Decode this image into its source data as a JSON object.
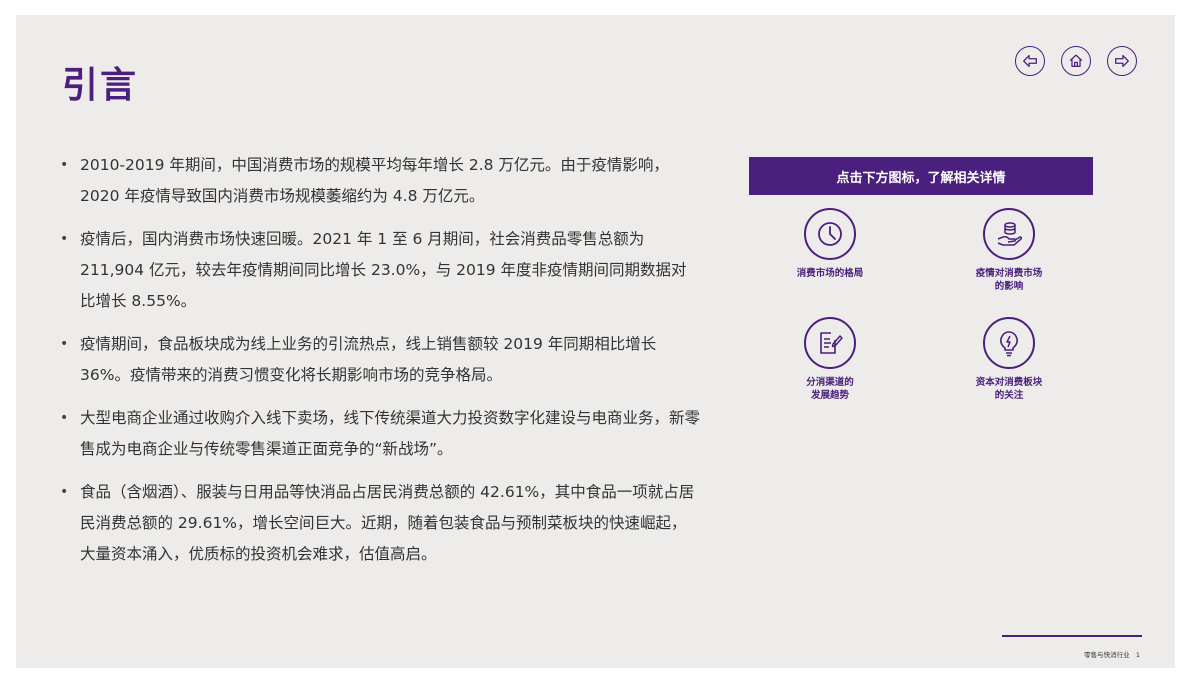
{
  "title": "引言",
  "nav": {
    "back_icon": "arrow-left-icon",
    "home_icon": "home-icon",
    "forward_icon": "arrow-right-icon"
  },
  "bullets": [
    "2010-2019 年期间，中国消费市场的规模平均每年增长 2.8 万亿元。由于疫情影响，2020 年疫情导致国内消费市场规模萎缩约为 4.8 万亿元。",
    "疫情后，国内消费市场快速回暖。2021 年 1 至 6 月期间，社会消费品零售总额为 211,904 亿元，较去年疫情期间同比增长 23.0%，与 2019 年度非疫情期间同期数据对比增长 8.55%。",
    "疫情期间，食品板块成为线上业务的引流热点，线上销售额较 2019 年同期相比增长 36%。疫情带来的消费习惯变化将长期影响市场的竞争格局。",
    "大型电商企业通过收购介入线下卖场，线下传统渠道大力投资数字化建设与电商业务，新零售成为电商企业与传统零售渠道正面竞争的“新战场”。",
    "食品（含烟酒）、服装与日用品等快消品占居民消费总额的 42.61%，其中食品一项就占居民消费总额的 29.61%，增长空间巨大。近期，随着包装食品与预制菜板块的快速崛起，大量资本涌入，优质标的投资机会难求，估值高启。"
  ],
  "panel": {
    "header": "点击下方图标，了解相关详情",
    "tiles": [
      {
        "label": "消费市场的格局",
        "icon": "clock-icon"
      },
      {
        "label": "疫情对消费市场\n的影响",
        "icon": "coins-hand-icon"
      },
      {
        "label": "分消渠道的\n发展趋势",
        "icon": "document-edit-icon"
      },
      {
        "label": "资本对消费板块\n的关注",
        "icon": "lightbulb-icon"
      }
    ]
  },
  "footer": {
    "text": "零售与快消行业",
    "page": "1"
  },
  "colors": {
    "accent": "#4a1f7d",
    "background": "#eeecea"
  }
}
